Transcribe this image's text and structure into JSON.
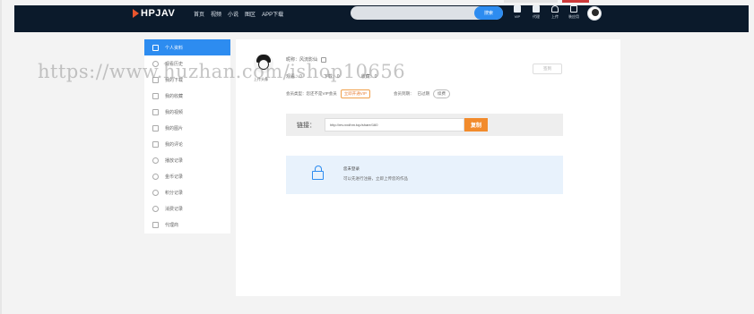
{
  "brand": {
    "logo_text": "HPJAV",
    "accent_color": "#2d8cf0",
    "topbar_color": "#0b1a2b",
    "promo_button_color": "#f28b2c"
  },
  "nav": {
    "items": [
      "首页",
      "视频",
      "小说",
      "图区",
      "APP下载"
    ]
  },
  "search": {
    "placeholder": "",
    "button_label": "搜索"
  },
  "toolbar": {
    "vip_label": "VIP",
    "agent_label": "代理",
    "upload_label": "上传",
    "install_label": "装应用"
  },
  "sidebar": {
    "items": [
      {
        "label": "个人资料",
        "icon": "user-icon"
      },
      {
        "label": "观看历史",
        "icon": "history-icon"
      },
      {
        "label": "我的下载",
        "icon": "download-icon"
      },
      {
        "label": "我的收藏",
        "icon": "star-icon"
      },
      {
        "label": "我的视频",
        "icon": "video-icon"
      },
      {
        "label": "我的图片",
        "icon": "image-icon"
      },
      {
        "label": "我的评论",
        "icon": "comment-icon"
      },
      {
        "label": "播放记录",
        "icon": "play-icon"
      },
      {
        "label": "金币记录",
        "icon": "coin-icon"
      },
      {
        "label": "积分记录",
        "icon": "points-icon"
      },
      {
        "label": "消费记录",
        "icon": "record-icon"
      },
      {
        "label": "代理商",
        "icon": "agent-icon"
      }
    ]
  },
  "profile": {
    "upload_avatar_label": "上传头像",
    "nickname": "昵称：风流影仙",
    "stats": [
      "观看：0",
      "下载：0",
      "收藏：0"
    ],
    "member_type": "会员类型：您还不是VIP会员",
    "vip_button": "立即开通VIP",
    "status_label": "会员到期：",
    "status_value": "已过期",
    "renew_button": "续费",
    "signin_button": "签到"
  },
  "promo": {
    "label": "链接：",
    "url": "http://mv.xxdhm.top/share/160",
    "copy_button": "复制"
  },
  "notice": {
    "title": "您未登录",
    "subtitle": "可以先进行注册，立即上传您的作品"
  },
  "watermark": "https://www.huzhan.com/ishop10656"
}
